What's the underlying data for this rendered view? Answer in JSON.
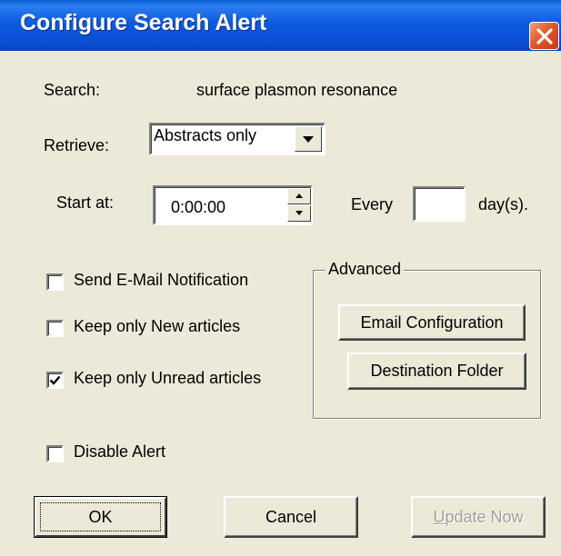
{
  "window": {
    "title": "Configure Search Alert",
    "close_icon": "close-icon"
  },
  "search": {
    "label": "Search:",
    "value": "surface plasmon resonance"
  },
  "retrieve": {
    "label": "Retrieve:",
    "selected": "Abstracts only"
  },
  "schedule": {
    "start_label": "Start at:",
    "start_value": "0:00:00",
    "every_label": "Every",
    "every_value": "",
    "days_label": "day(s)."
  },
  "options": [
    {
      "label": "Send E-Mail Notification",
      "checked": false
    },
    {
      "label": "Keep only New articles",
      "checked": false
    },
    {
      "label": "Keep only Unread articles",
      "checked": true
    },
    {
      "label": "Disable Alert",
      "checked": false
    }
  ],
  "advanced": {
    "legend": "Advanced",
    "email_config_label": "Email Configuration",
    "destination_label": "Destination Folder"
  },
  "buttons": {
    "ok": "OK",
    "cancel": "Cancel",
    "update_now": "Update Now",
    "update_now_enabled": false
  },
  "colors": {
    "titlebar": "#0a4fd3",
    "dialog_bg": "#ece9d8",
    "close_button": "#e0582c",
    "disabled_text": "#a0a0a0"
  }
}
